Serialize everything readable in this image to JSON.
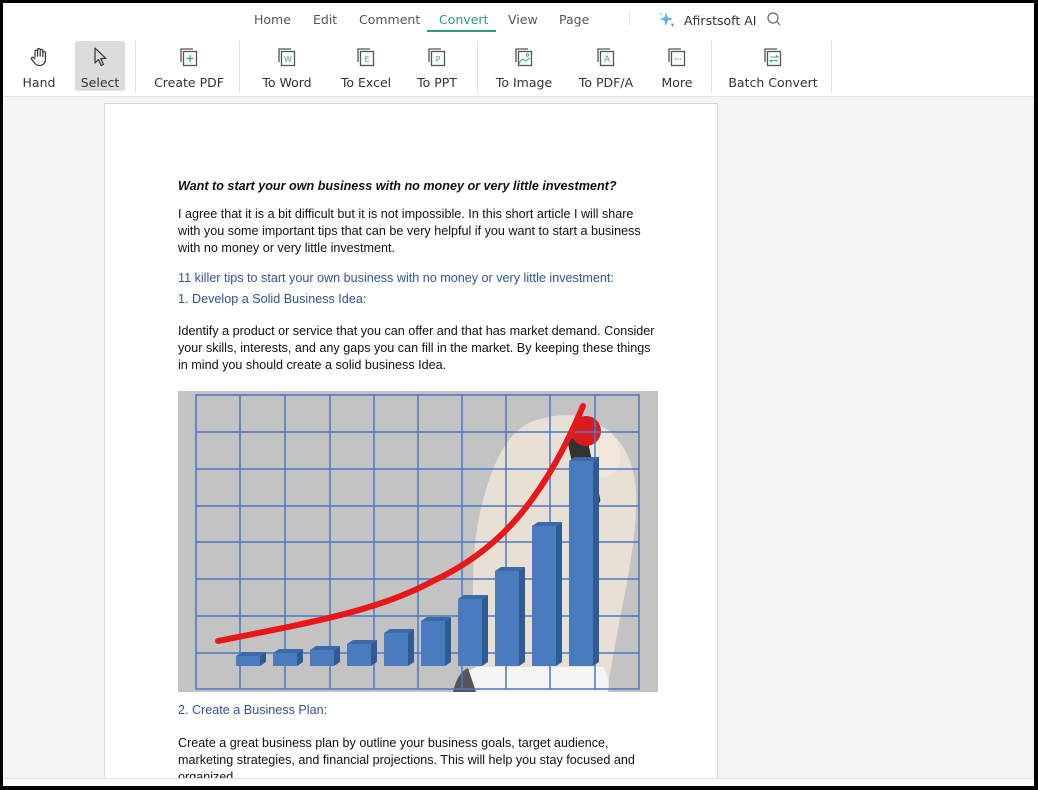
{
  "menu": {
    "tabs": [
      {
        "label": "Home"
      },
      {
        "label": "Edit"
      },
      {
        "label": "Comment"
      },
      {
        "label": "Convert",
        "active": true
      },
      {
        "label": "View"
      },
      {
        "label": "Page"
      }
    ],
    "ai_label": "Afirstsoft AI",
    "accent_color": "#2e9b74"
  },
  "toolbar": {
    "items": [
      {
        "label": "Hand",
        "icon": "hand-icon"
      },
      {
        "label": "Select",
        "icon": "cursor-icon",
        "selected": true
      },
      {
        "label": "Create PDF",
        "icon": "create-pdf-icon"
      },
      {
        "label": "To Word",
        "icon": "to-word-icon",
        "glyph": "W"
      },
      {
        "label": "To Excel",
        "icon": "to-excel-icon",
        "glyph": "E"
      },
      {
        "label": "To PPT",
        "icon": "to-ppt-icon",
        "glyph": "P"
      },
      {
        "label": "To Image",
        "icon": "to-image-icon"
      },
      {
        "label": "To PDF/A",
        "icon": "to-pdfa-icon",
        "glyph": "A"
      },
      {
        "label": "More",
        "icon": "more-icon",
        "glyph": "..."
      },
      {
        "label": "Batch Convert",
        "icon": "batch-convert-icon"
      }
    ]
  },
  "document": {
    "title": "Want to start your own business with no money or very little investment?",
    "intro": "I agree that it is a bit difficult but it is not impossible. In this short article I will share with you some important tips that can be very helpful if you want to start a business with no money or very little investment.",
    "tips_heading": "11 killer tips to start your own business with no money or very little investment:",
    "tip1_heading": "1. Develop a Solid Business Idea:",
    "tip1_body": "Identify a product or service that you can offer and that has market demand. Consider your skills, interests, and any gaps you can fill in the market. By keeping these things in mind you should create a solid business Idea.",
    "image_alt": "Hand drawing a rising red growth curve over a blue bar chart on a grid",
    "tip2_heading": "2. Create a Business Plan:",
    "tip2_body": "Create a great business plan by outline your business goals, target audience, marketing strategies, and financial projections. This will help you stay focused and organized."
  }
}
